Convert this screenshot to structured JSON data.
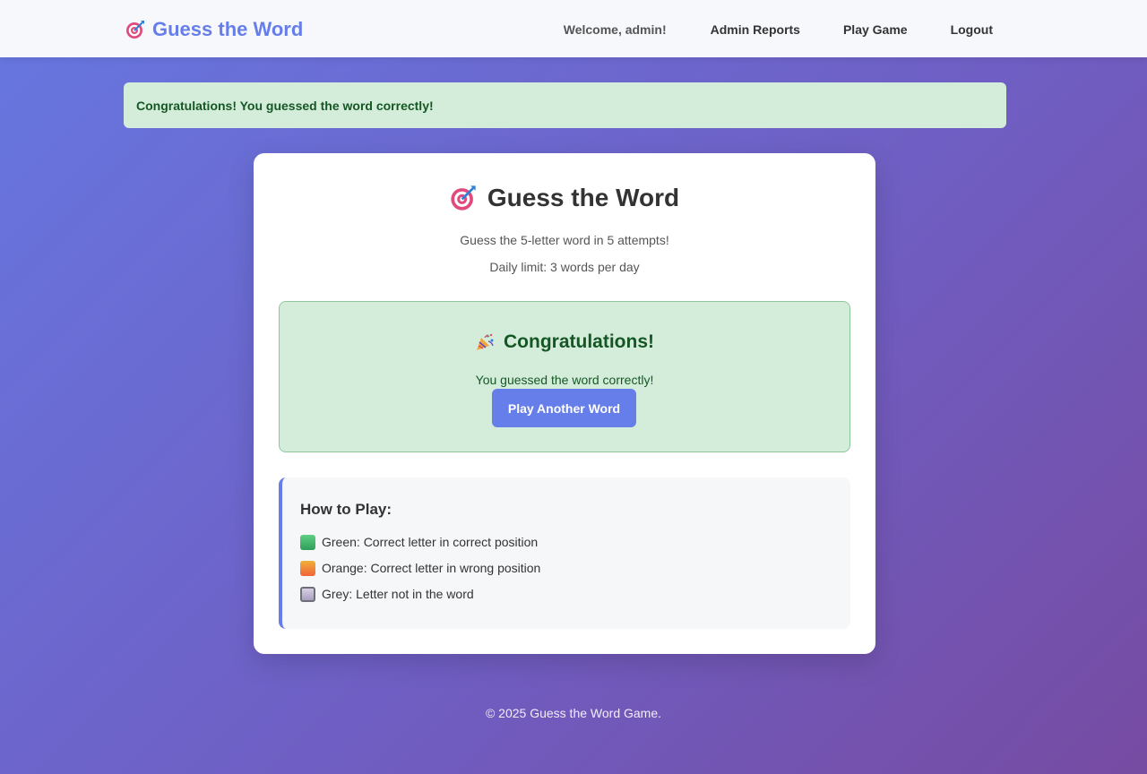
{
  "navbar": {
    "brand": "Guess the Word",
    "brand_icon": "target-icon",
    "welcome": "Welcome, admin!",
    "links": [
      "Admin Reports",
      "Play Game",
      "Logout"
    ]
  },
  "flash": {
    "message": "Congratulations! You guessed the word correctly!"
  },
  "card": {
    "title": "Guess the Word",
    "title_icon": "target-icon",
    "instructions": "Guess the 5-letter word in 5 attempts!",
    "daily_limit": "Daily limit: 3 words per day"
  },
  "result": {
    "icon": "party-popper-icon",
    "title": "Congratulations!",
    "message": "You guessed the word correctly!",
    "button_label": "Play Another Word"
  },
  "how_to_play": {
    "title": "How to Play:",
    "items": [
      {
        "color": "#3fb56f",
        "text": "Green: Correct letter in correct position"
      },
      {
        "color": "#f08a3a",
        "text": "Orange: Correct letter in wrong position"
      },
      {
        "color": "#b8aed0",
        "text": "Grey: Letter not in the word"
      }
    ]
  },
  "footer": {
    "text": "© 2025 Guess the Word Game."
  },
  "colors": {
    "accent": "#667eea",
    "success_bg": "#d4edda",
    "success_text": "#155724"
  }
}
